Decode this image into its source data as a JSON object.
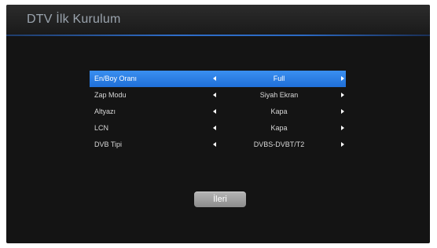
{
  "header": {
    "title": "DTV İlk Kurulum"
  },
  "menu": {
    "items": [
      {
        "label": "En/Boy Oranı",
        "value": "Full",
        "selected": true
      },
      {
        "label": "Zap Modu",
        "value": "Siyah Ekran",
        "selected": false
      },
      {
        "label": "Altyazı",
        "value": "Kapa",
        "selected": false
      },
      {
        "label": "LCN",
        "value": "Kapa",
        "selected": false
      },
      {
        "label": "DVB Tipi",
        "value": "DVBS-DVBT/T2",
        "selected": false
      }
    ]
  },
  "footer": {
    "next_label": "İleri"
  },
  "colors": {
    "background": "#141414",
    "selection": "#2a7fe8",
    "header_accent": "#2f6dc8",
    "button": "#a0a0a0"
  }
}
